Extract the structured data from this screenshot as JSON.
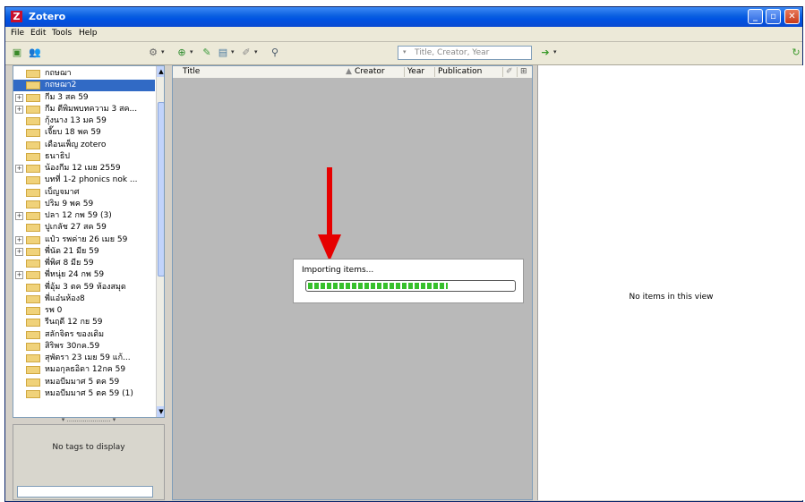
{
  "window": {
    "title": "Zotero",
    "app_icon": "Z"
  },
  "menubar": {
    "items": [
      "File",
      "Edit",
      "Tools",
      "Help"
    ]
  },
  "toolbar": {
    "search_placeholder": "Title, Creator, Year"
  },
  "collections": [
    {
      "label": "กถษฌา",
      "expandable": false
    },
    {
      "label": "กถษฌา2",
      "expandable": false,
      "selected": true
    },
    {
      "label": "กีม 3 สค 59",
      "expandable": true
    },
    {
      "label": "กีม ตีพิมพบทความ 3 สค...",
      "expandable": true
    },
    {
      "label": "กุ้งนาง 13 มค 59",
      "expandable": false
    },
    {
      "label": "เจี๊ยบ 18 พค 59",
      "expandable": false
    },
    {
      "label": "เดือนเพ็ญ zotero",
      "expandable": false
    },
    {
      "label": "ธนาธิป",
      "expandable": false
    },
    {
      "label": "น้องกีม 12 เมย 2559",
      "expandable": true
    },
    {
      "label": "บทที่ 1-2 phonics nok ...",
      "expandable": false
    },
    {
      "label": "เบ็ญจมาศ",
      "expandable": false
    },
    {
      "label": "ปริม 9 พค 59",
      "expandable": false
    },
    {
      "label": "ปลา 12 กพ 59 (3)",
      "expandable": true
    },
    {
      "label": "ปูเกลัช 27 สค 59",
      "expandable": false
    },
    {
      "label": "แป๋ว รพค่าย 26 เมย 59",
      "expandable": true
    },
    {
      "label": "พี่นัด 21 มีย 59",
      "expandable": true
    },
    {
      "label": "พี่พิศ 8 มีย 59",
      "expandable": false
    },
    {
      "label": "พี่หนุ่ย 24 กพ 59",
      "expandable": true
    },
    {
      "label": "พี่อุ้ม 3 ตค 59 ห้องสมุด",
      "expandable": false
    },
    {
      "label": "พี่แอ๋นห้อง8",
      "expandable": false
    },
    {
      "label": "รพ 0",
      "expandable": false
    },
    {
      "label": "รีนฤดี 12 กย 59",
      "expandable": false
    },
    {
      "label": "สลักจิตร ของเดิม",
      "expandable": false
    },
    {
      "label": "สิริพร 30กค.59",
      "expandable": false
    },
    {
      "label": "สุพัตรา 23 เมย 59 แก้...",
      "expandable": false
    },
    {
      "label": "หมอกุลธอิดา 12กค 59",
      "expandable": false
    },
    {
      "label": "หมอบีมมาศ 5 ตค 59",
      "expandable": false
    },
    {
      "label": "หมอบีมมาศ 5 ตค 59 (1)",
      "expandable": false
    }
  ],
  "tags": {
    "empty_text": "No tags to display"
  },
  "items": {
    "columns": {
      "title": "Title",
      "creator": "Creator",
      "year": "Year",
      "publication": "Publication"
    }
  },
  "itempane": {
    "empty_text": "No items in this view"
  },
  "import_dialog": {
    "label": "Importing items...",
    "progress": 0.68
  }
}
